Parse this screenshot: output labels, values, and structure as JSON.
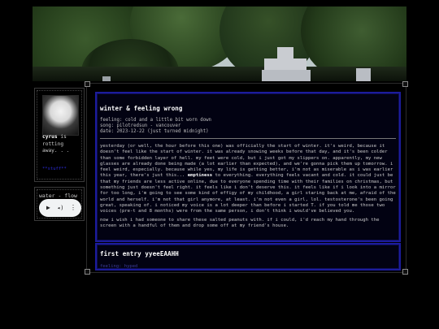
{
  "banner": {
    "alt": "cemetery cross under trees"
  },
  "profile": {
    "name": "cyrus",
    "status": "is rotting away. . .",
    "link": "**stuff**"
  },
  "music": {
    "title": "water - flow"
  },
  "entries": [
    {
      "title": "winter & feeling wrong",
      "feeling": "feeling: cold and a little bit worn down",
      "song": "song: pilotredsun - vancouver",
      "date": "date: 2023-12-22 (just turned midnight)",
      "p1_start": "yesterday (or well, the hour before this one) was officially the start of winter. it's weird, because it doesn't feel like the start of winter. it was already snowing weeks before that day, and it's been colder than some forbidden layer of hell. my feet were cold, but i just got my slippers on. apparently, my new glasses are already done being made (a lot earlier than expected), and we're gonna pick them up tomorrow. i feel weird, especially. because while yes, my life is getting better, i'm not as miserable as i was earlier this year, there's just this...",
      "p1_highlight": "emptiness",
      "p1_end": "to everything. everything feels vacant and cold. it could just be that my friends are less active online, due to everyone spending time with their families on christmas, but something just doesn't feel right. it feels like i don't deserve this. it feels like if i look into a mirror for too long, i'm going to see some kind of effigy of my childhood, a girl staring back at me, afraid of the world and herself. i'm not that girl anymore, at least. i'm not even a girl, lol. testosterone's been going great, speaking of. i noticed my voice is a lot deeper than before i started T. if you told me those two voices (pre-t and 8 months) were from the same person, i don't think i would've believed you.",
      "p2": "now i wish i had someone to share these salted peanuts with. if i could, i'd reach my hand through the screen with a handful of them and drop some off at my friend's house."
    },
    {
      "title": "first entry yyeeEAAHH",
      "peek": "feeling: hyped"
    }
  ]
}
